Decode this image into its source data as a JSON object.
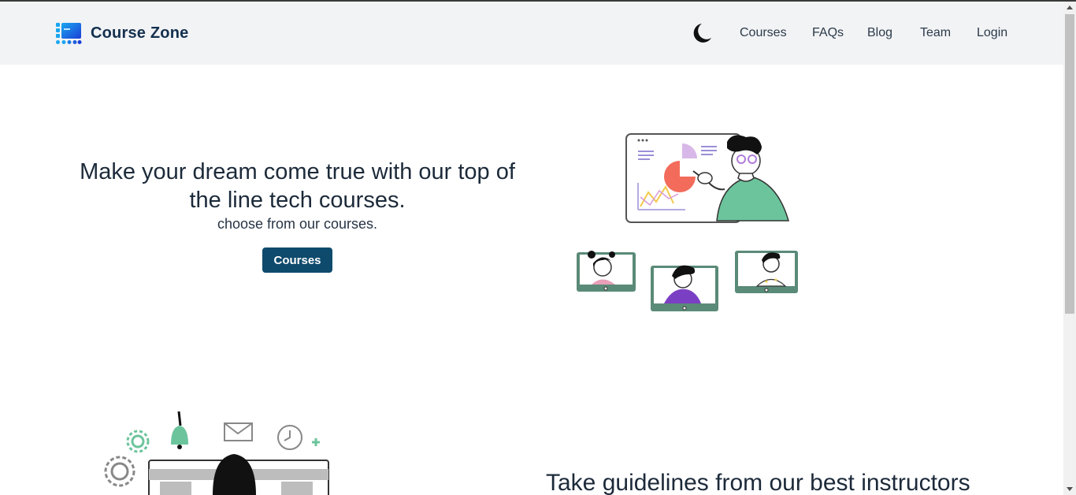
{
  "header": {
    "brand": "Course Zone",
    "nav": [
      {
        "label": "Courses"
      },
      {
        "label": "FAQs"
      },
      {
        "label": "Blog"
      },
      {
        "label": "Team"
      },
      {
        "label": "Login"
      }
    ],
    "theme_icon": "moon-icon"
  },
  "hero": {
    "title": "Make your dream come true with our top of the line tech courses.",
    "subtitle": "choose from our courses.",
    "button_label": "Courses"
  },
  "section2": {
    "title": "Take guidelines from our best instructors"
  },
  "colors": {
    "brand": "#14304f",
    "button": "#0e4a6c",
    "navbar_bg": "#f2f3f5",
    "illustration_green": "#6cc49c"
  }
}
